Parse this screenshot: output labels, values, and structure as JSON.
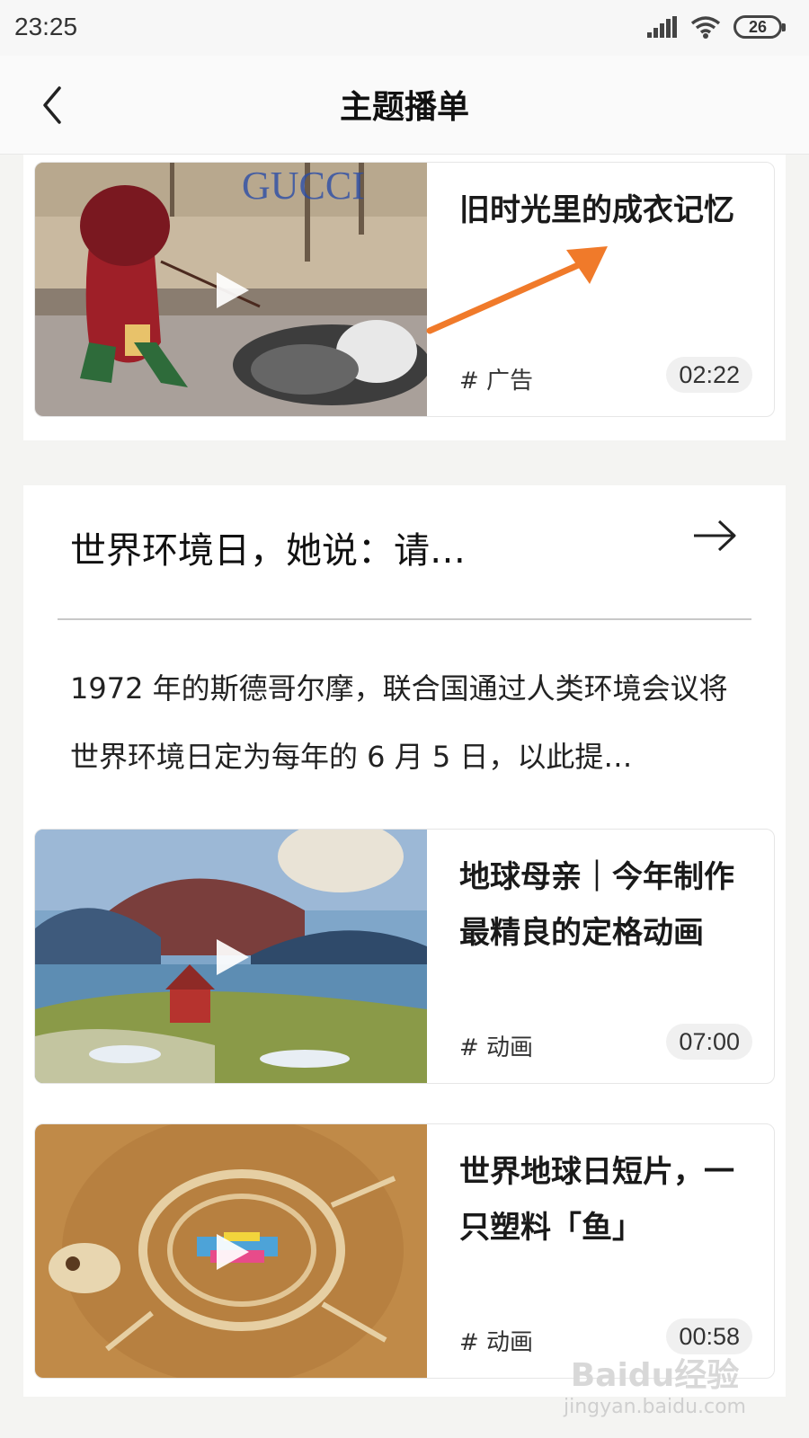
{
  "status_bar": {
    "time": "23:25",
    "battery": "26"
  },
  "header": {
    "title": "主题播单"
  },
  "cards": [
    {
      "title": "旧时光里的成衣记忆",
      "tag": "# 广告",
      "duration": "02:22"
    },
    {
      "title": "地球母亲｜今年制作最精良的定格动画",
      "tag": "# 动画",
      "duration": "07:00"
    },
    {
      "title": "世界地球日短片，一只塑料「鱼」",
      "tag": "# 动画",
      "duration": "00:58"
    }
  ],
  "section": {
    "title": "世界环境日，她说：请…",
    "description": "1972 年的斯德哥尔摩，联合国通过人类环境会议将世界环境日定为每年的 6 月 5 日，以此提…"
  },
  "watermark": {
    "main": "Baidu经验",
    "sub": "jingyan.baidu.com"
  },
  "colors": {
    "annotation_arrow": "#f07a2a",
    "page_bg": "#f4f4f2",
    "duration_bg": "#f0f0f0"
  }
}
